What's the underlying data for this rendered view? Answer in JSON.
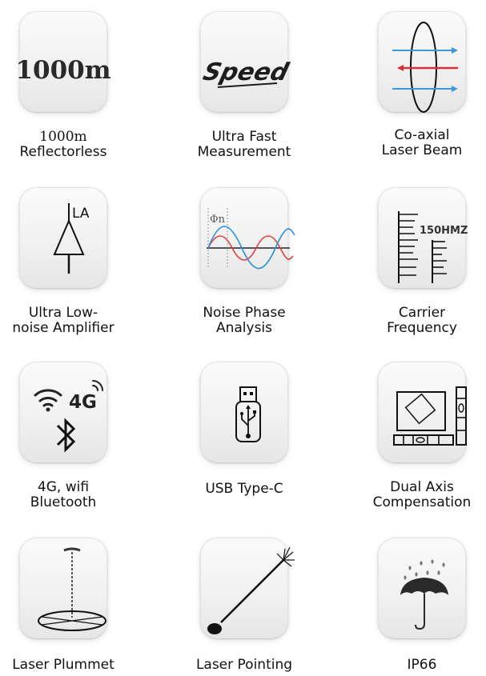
{
  "features": [
    {
      "id": "reflectorless",
      "icon": "1000m-text-icon",
      "icon_text": "1000m",
      "label": [
        "1000m",
        "Reflectorless"
      ]
    },
    {
      "id": "speed",
      "icon": "speed-text-icon",
      "icon_text": "Speed",
      "label": [
        "Ultra Fast",
        "Measurement"
      ]
    },
    {
      "id": "coaxial",
      "icon": "coaxial-beam-icon",
      "label": [
        "Co-axial",
        "Laser Beam"
      ]
    },
    {
      "id": "amplifier",
      "icon": "amplifier-symbol-icon",
      "icon_text": "LA",
      "label": [
        "Ultra Low-",
        "noise Amplifier"
      ]
    },
    {
      "id": "phase",
      "icon": "phase-wave-icon",
      "icon_text": "Φn",
      "label": [
        "Noise Phase",
        "Analysis"
      ]
    },
    {
      "id": "carrier",
      "icon": "frequency-bars-icon",
      "icon_text": "150HMZ",
      "label": [
        "Carrier",
        "Frequency"
      ]
    },
    {
      "id": "connectivity",
      "icon": "wifi-4g-bluetooth-icon",
      "icon_text": "4G",
      "label": [
        "4G, wifi",
        "Bluetooth"
      ]
    },
    {
      "id": "usb",
      "icon": "usb-drive-icon",
      "label": [
        "USB Type-C"
      ]
    },
    {
      "id": "compensation",
      "icon": "dual-axis-level-icon",
      "label": [
        "Dual Axis",
        "Compensation"
      ]
    },
    {
      "id": "plummet",
      "icon": "laser-plummet-icon",
      "label": [
        "Laser Plummet"
      ]
    },
    {
      "id": "pointing",
      "icon": "laser-pointing-icon",
      "label": [
        "Laser Pointing"
      ]
    },
    {
      "id": "ip66",
      "icon": "umbrella-rain-icon",
      "label": [
        "IP66"
      ]
    }
  ],
  "colors": {
    "beam_blue": "#3a9ad9",
    "beam_red": "#d8303a",
    "wave_red": "#e04040",
    "wave_blue": "#2a8fd8"
  }
}
